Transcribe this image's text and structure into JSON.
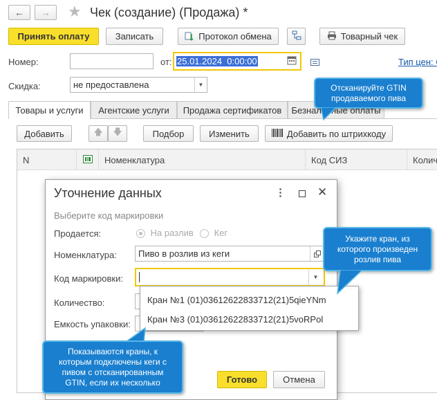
{
  "window": {
    "title": "Чек (создание) (Продажа) *"
  },
  "toolbar": {
    "accept_payment": "Принять оплату",
    "write": "Записать",
    "exchange_log": "Протокол обмена",
    "product_receipt": "Товарный чек"
  },
  "header": {
    "number_label": "Номер:",
    "number_value": "",
    "date_label": "от:",
    "date_value": "25.01.2024  0:00:00",
    "price_type_link": "Тип цен: С",
    "discount_label": "Скидка:",
    "discount_value": "не предоставлена"
  },
  "tabs": [
    {
      "label": "Товары и услуги"
    },
    {
      "label": "Агентские услуги"
    },
    {
      "label": "Продажа сертификатов"
    },
    {
      "label": "Безналичные оплаты"
    }
  ],
  "table_toolbar": {
    "add": "Добавить",
    "selection": "Подбор",
    "edit": "Изменить",
    "add_by_barcode": "Добавить по штрихкоду"
  },
  "table": {
    "columns": [
      "N",
      "",
      "Номенклатура",
      "Код СИЗ",
      "Колич"
    ]
  },
  "dialog": {
    "title": "Уточнение данных",
    "subtitle": "Выберите код маркировки",
    "sold_label": "Продается:",
    "sold_option1": "На разлив",
    "sold_option2": "Кег",
    "nomenclature_label": "Номенклатура:",
    "nomenclature_value": "Пиво в розлив из кеги",
    "marking_code_label": "Код маркировки:",
    "marking_code_value": "",
    "quantity_label": "Количество:",
    "package_label": "Емкость упаковки:",
    "ok": "Готово",
    "cancel": "Отмена",
    "dropdown_options": [
      "Кран №1 (01)03612622833712(21)5qieYNm",
      "Кран №3 (01)03612622833712(21)5voRPol"
    ]
  },
  "tooltips": {
    "scan_gtin": "Отсканируйте GTIN продаваемого пива",
    "choose_tap": "Укажите кран, из которого произведен розлив пива",
    "taps_shown": "Показываются краны, к которым подключены кеги с пивом с отсканированным GTIN, если их несколько"
  },
  "colors": {
    "accent_yellow": "#f9df2b",
    "tooltip_blue": "#1a7fcf",
    "date_highlight": "#3a6fd8",
    "link_blue": "#1155aa"
  }
}
